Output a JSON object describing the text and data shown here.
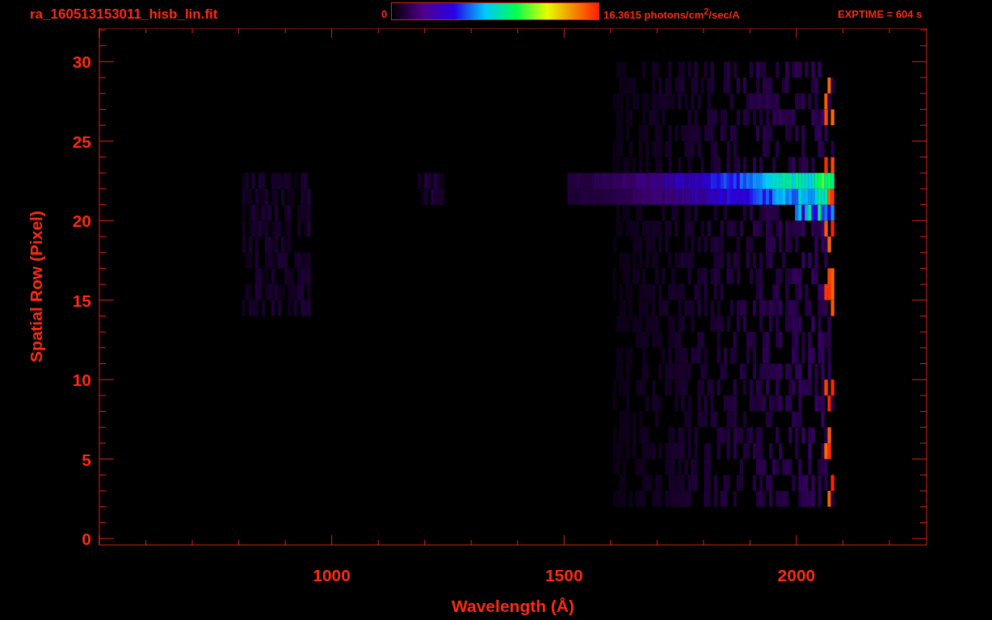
{
  "header": {
    "file_name": "ra_160513153011_hisb_lin.fit",
    "colorbar": {
      "min_label": "0",
      "max_label": "16.3615 photons/cm$^{2}$/sec/A"
    },
    "exposure": "EXPTIME = 604 s"
  },
  "plot": {
    "xlabel": "Wavelength (Å)",
    "ylabel": "Spatial Row (Pixel)",
    "xticks": [
      "1000",
      "1500",
      "2000"
    ],
    "yticks": [
      "30",
      "25",
      "20",
      "15",
      "10",
      "5",
      "0"
    ]
  }
}
